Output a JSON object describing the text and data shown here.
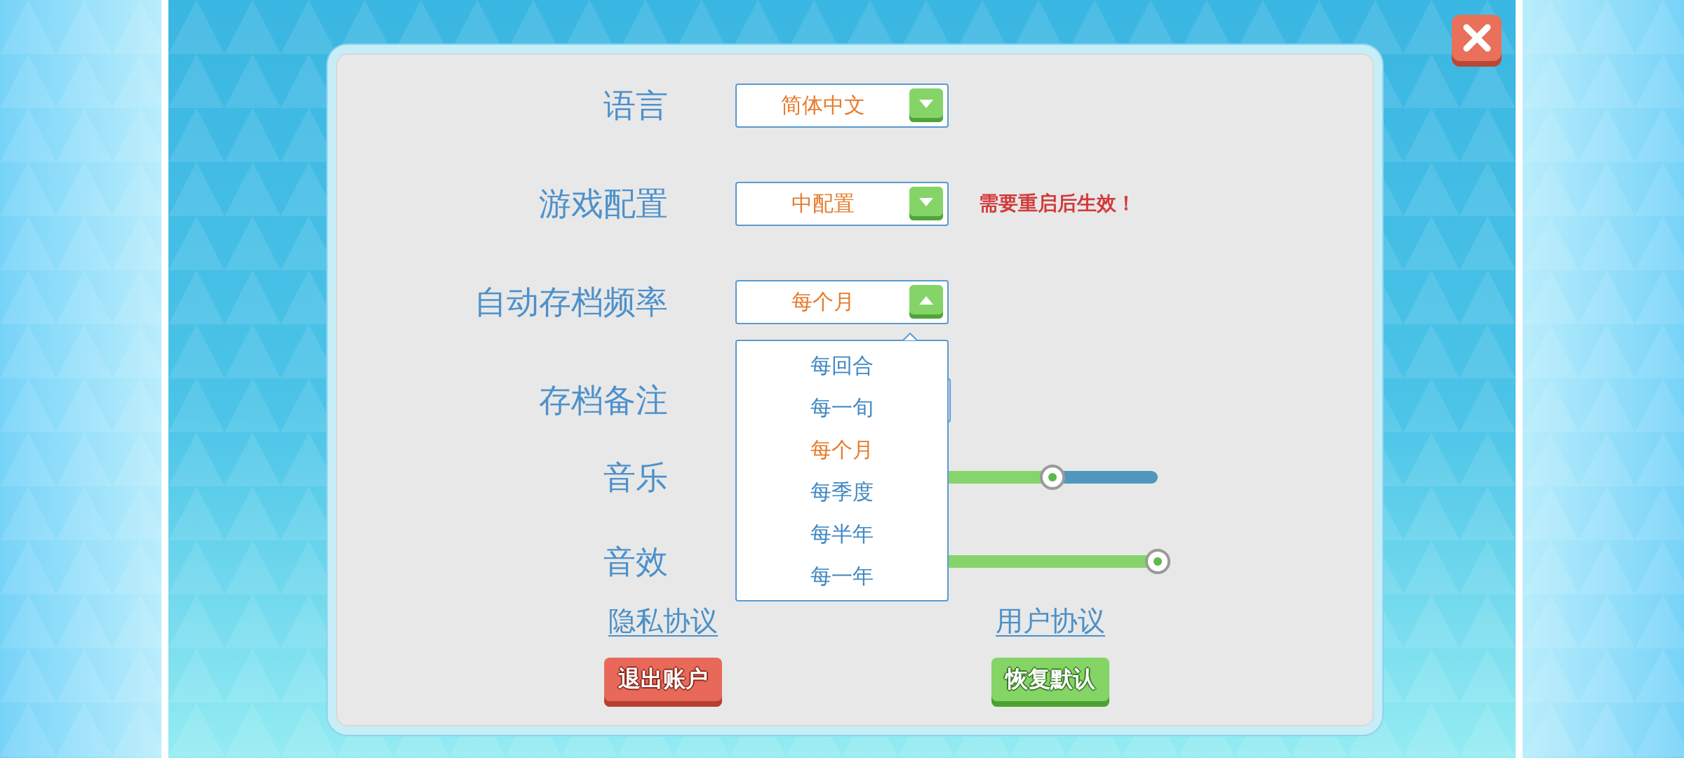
{
  "settings": [
    {
      "kind": "dropdown",
      "label": "语言",
      "value": "简体中文",
      "expanded": false
    },
    {
      "kind": "dropdown",
      "label": "游戏配置",
      "value": "中配置",
      "expanded": false,
      "note": "需要重启后生效！"
    },
    {
      "kind": "dropdown",
      "label": "自动存档频率",
      "value": "每个月",
      "expanded": true,
      "options": [
        {
          "label": "每回合",
          "selected": false
        },
        {
          "label": "每一旬",
          "selected": false
        },
        {
          "label": "每个月",
          "selected": true
        },
        {
          "label": "每季度",
          "selected": false
        },
        {
          "label": "每半年",
          "selected": false
        },
        {
          "label": "每一年",
          "selected": false
        }
      ]
    },
    {
      "kind": "text_input",
      "label": "存档备注"
    },
    {
      "kind": "slider",
      "label": "音乐",
      "level": 0.75
    },
    {
      "kind": "slider",
      "label": "音效",
      "level": 1
    }
  ],
  "links": [
    "隐私协议",
    "用户协议"
  ],
  "buttons": [
    {
      "label": "退出账户",
      "kind": "danger"
    },
    {
      "label": "恢复默认",
      "kind": "confirm"
    }
  ]
}
